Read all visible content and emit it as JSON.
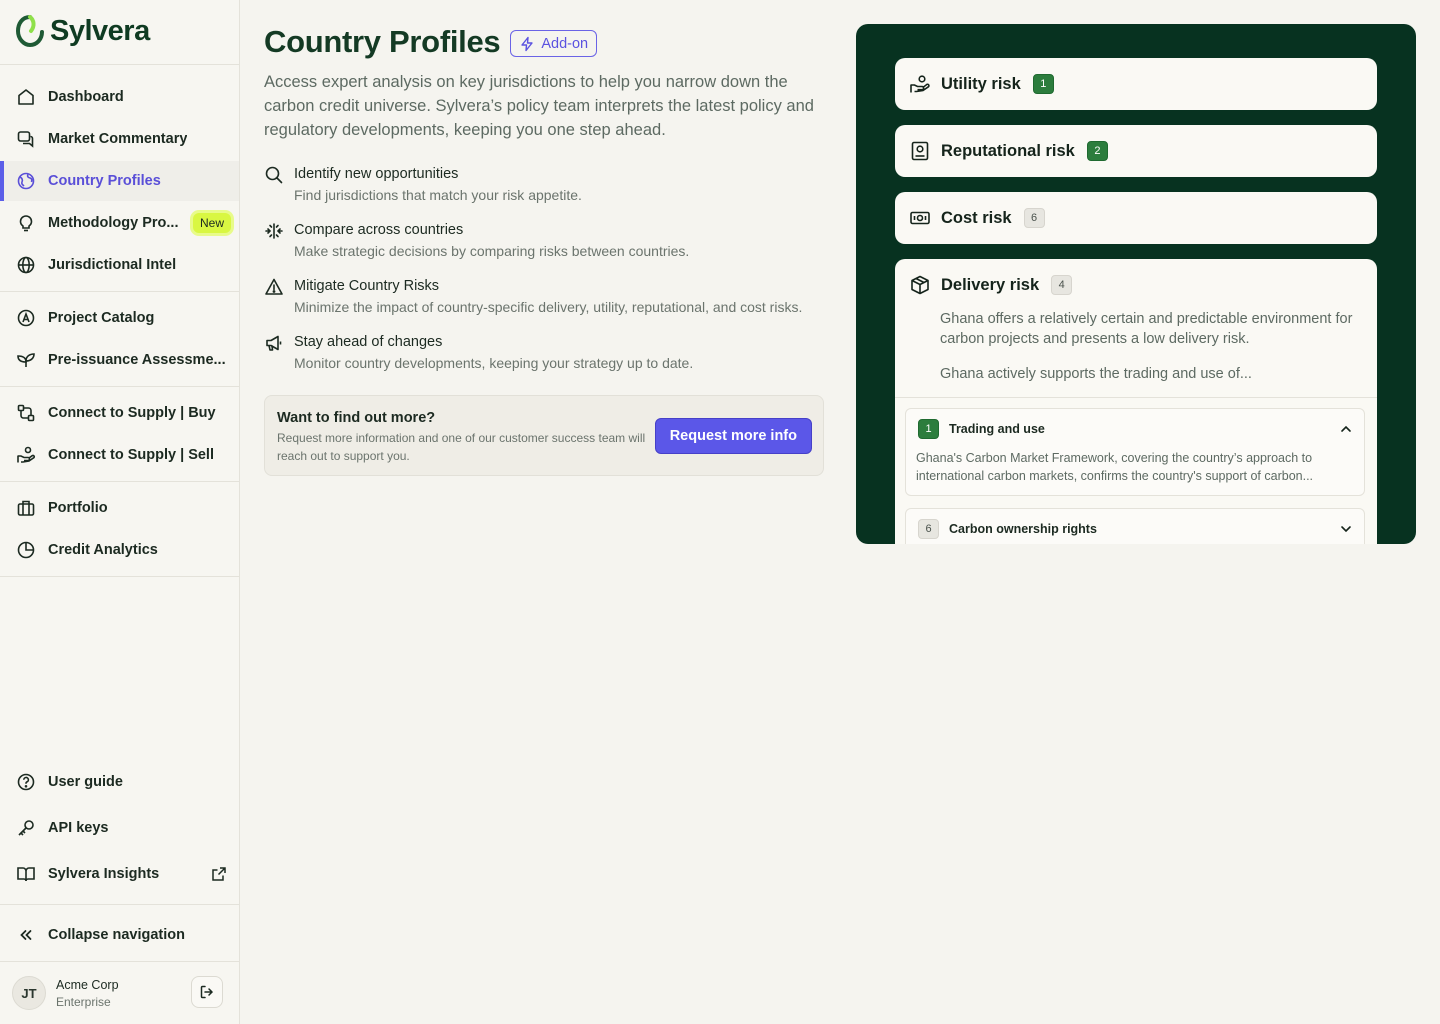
{
  "brand": {
    "name": "Sylvera"
  },
  "colors": {
    "accent": "#5b57e8",
    "brand_dark": "#073220",
    "new_badge": "#d9f742"
  },
  "sidebar": {
    "items": [
      {
        "label": "Dashboard",
        "icon": "home-icon"
      },
      {
        "label": "Market Commentary",
        "icon": "chat-icon"
      },
      {
        "label": "Country Profiles",
        "icon": "globe-icon",
        "active": true
      },
      {
        "label": "Methodology Pro...",
        "icon": "lightbulb-icon",
        "badge": "New"
      },
      {
        "label": "Jurisdictional Intel",
        "icon": "globe-grid-icon"
      },
      {
        "label": "Project Catalog",
        "icon": "compass-icon"
      },
      {
        "label": "Pre-issuance Assessme...",
        "icon": "sprout-icon"
      },
      {
        "label": "Connect to Supply | Buy",
        "icon": "link-icon"
      },
      {
        "label": "Connect to Supply | Sell",
        "icon": "hand-coin-icon"
      },
      {
        "label": "Portfolio",
        "icon": "briefcase-icon"
      },
      {
        "label": "Credit Analytics",
        "icon": "pie-chart-icon"
      }
    ],
    "footer_items": [
      {
        "label": "User guide",
        "icon": "help-icon"
      },
      {
        "label": "API keys",
        "icon": "key-icon"
      },
      {
        "label": "Sylvera Insights",
        "icon": "book-icon"
      }
    ],
    "collapse_label": "Collapse navigation",
    "user": {
      "initials": "JT",
      "org": "Acme Corp",
      "plan": "Enterprise"
    }
  },
  "main": {
    "title": "Country Profiles",
    "addon_label": "Add-on",
    "intro": "Access expert analysis on key jurisdictions to help you narrow down the carbon credit universe. Sylvera’s policy team interprets the latest policy and regulatory developments, keeping you one step ahead.",
    "features": [
      {
        "title": "Identify new opportunities",
        "desc": "Find jurisdictions that match your risk appetite.",
        "icon": "search-icon"
      },
      {
        "title": "Compare across countries",
        "desc": "Make strategic decisions by comparing risks between countries.",
        "icon": "compare-icon"
      },
      {
        "title": "Mitigate Country Risks",
        "desc": "Minimize the impact of country-specific delivery, utility, reputational, and cost risks.",
        "icon": "warning-icon"
      },
      {
        "title": "Stay ahead of changes",
        "desc": "Monitor country developments, keeping your strategy up to date.",
        "icon": "megaphone-icon"
      }
    ],
    "cta": {
      "title": "Want to find out more?",
      "desc": "Request more information and one of our customer success team will reach out to support you.",
      "button": "Request more info"
    }
  },
  "panel": {
    "risks": [
      {
        "title": "Utility risk",
        "count": "1",
        "tone": "green",
        "icon": "hand-coin-icon"
      },
      {
        "title": "Reputational risk",
        "count": "2",
        "tone": "green",
        "icon": "badge-id-icon"
      },
      {
        "title": "Cost risk",
        "count": "6",
        "tone": "gray",
        "icon": "banknote-icon"
      }
    ],
    "delivery": {
      "title": "Delivery risk",
      "count": "4",
      "p1": "Ghana offers a relatively certain and predictable environment for carbon projects and presents a low delivery risk.",
      "p2": "Ghana actively supports the trading and use of...",
      "sections": [
        {
          "count": "1",
          "title": "Trading and use",
          "text": "Ghana's Carbon Market Framework, covering the country’s approach to international carbon markets, confirms the country's support of carbon...",
          "expanded": true
        },
        {
          "count": "6",
          "title": "Carbon ownership rights",
          "expanded": false
        }
      ]
    }
  }
}
